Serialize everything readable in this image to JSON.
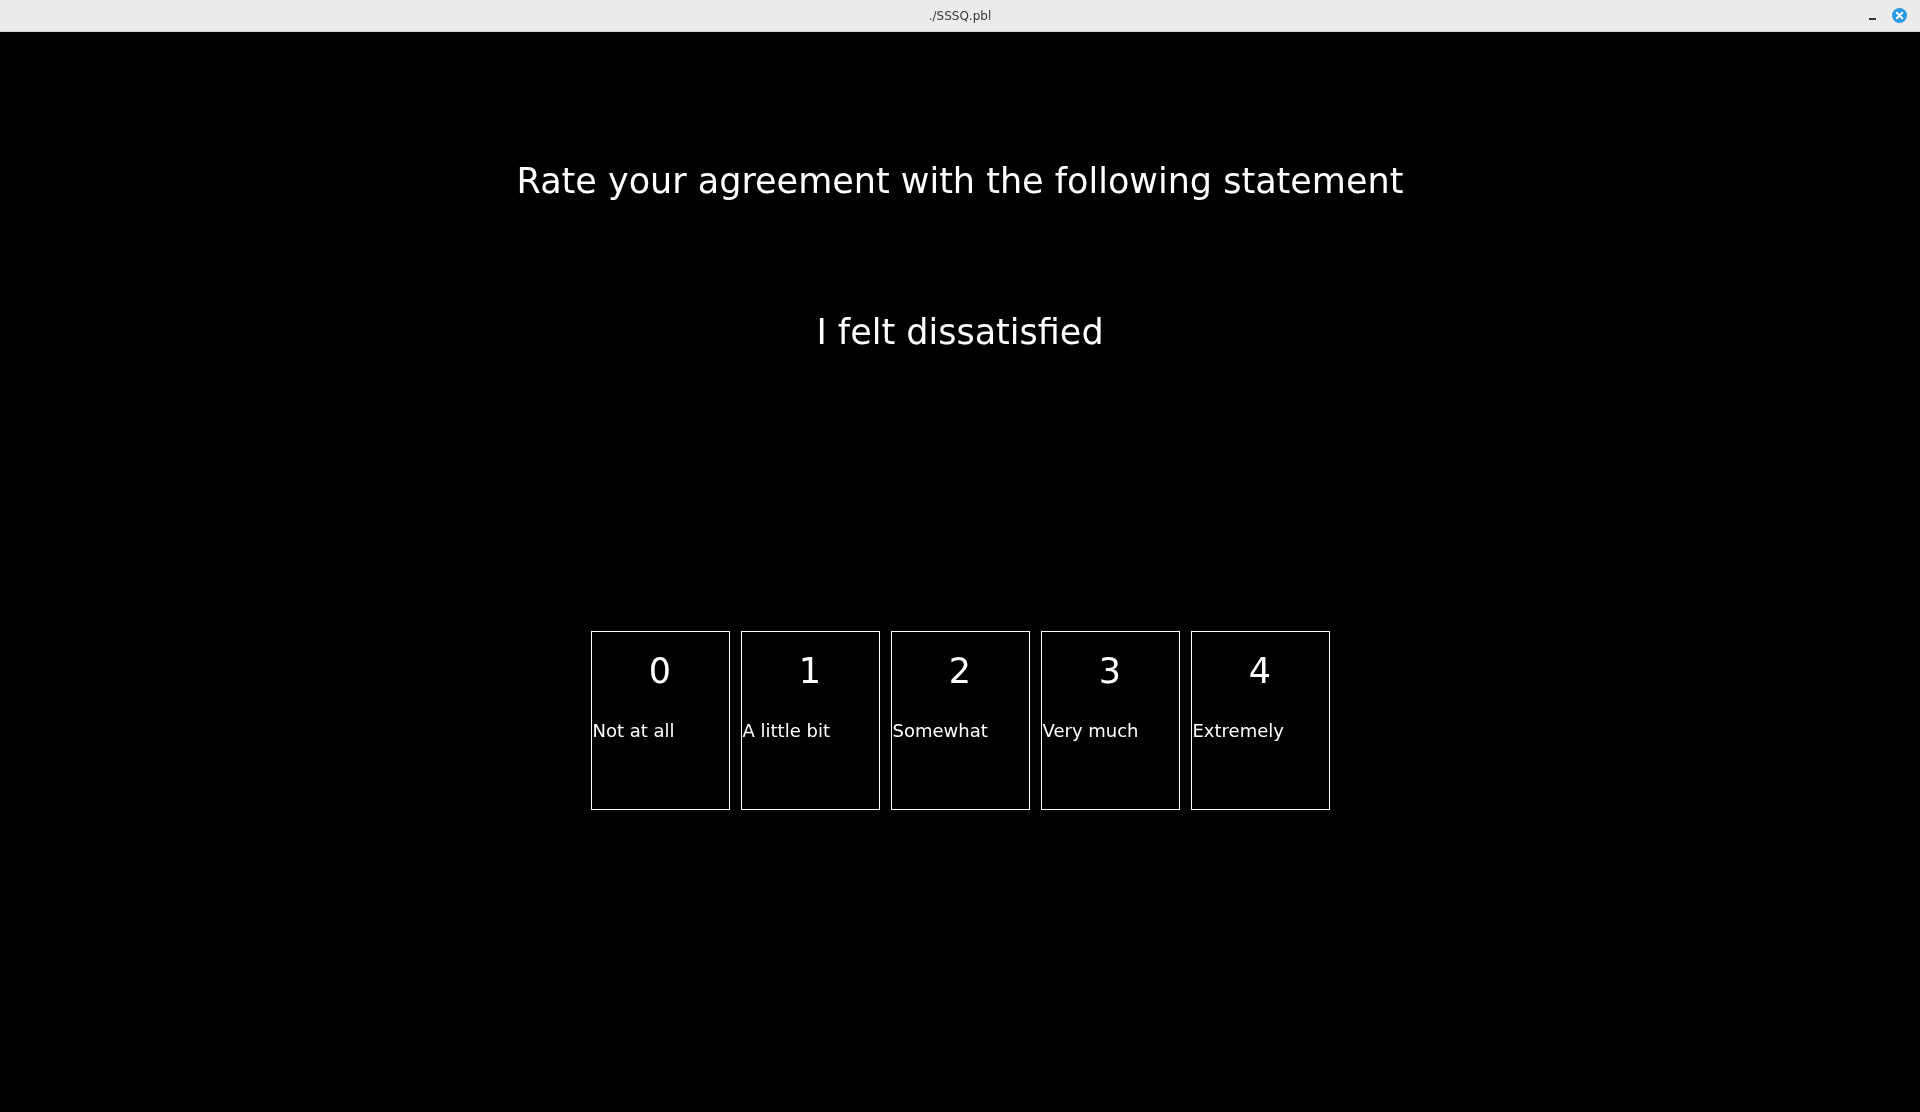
{
  "window": {
    "title": "./SSSQ.pbl"
  },
  "prompt": "Rate your agreement with the following statement",
  "statement": "I felt dissatisfied",
  "options": [
    {
      "value": "0",
      "label": "Not at all"
    },
    {
      "value": "1",
      "label": "A little bit"
    },
    {
      "value": "2",
      "label": "Somewhat"
    },
    {
      "value": "3",
      "label": "Very much"
    },
    {
      "value": "4",
      "label": "Extremely"
    }
  ]
}
